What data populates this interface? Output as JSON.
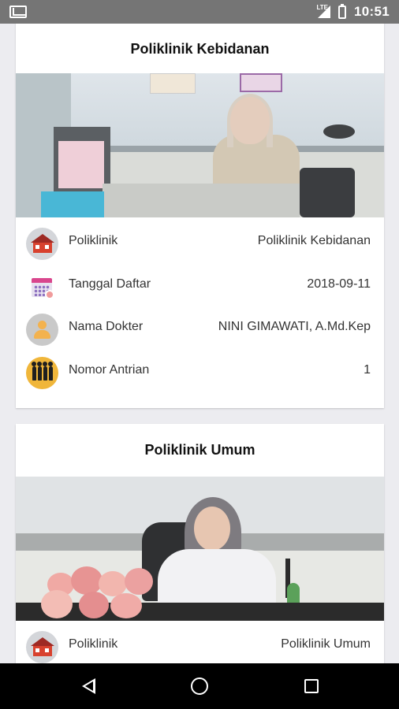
{
  "status_bar": {
    "network": "LTE",
    "time": "10:51",
    "icons": [
      "gmail-icon",
      "signal-icon",
      "battery-icon"
    ]
  },
  "cards": [
    {
      "title": "Poliklinik Kebidanan",
      "rows": [
        {
          "icon": "house-icon",
          "label": "Poliklinik",
          "value": "Poliklinik Kebidanan"
        },
        {
          "icon": "calendar-icon",
          "label": "Tanggal Daftar",
          "value": "2018-09-11"
        },
        {
          "icon": "doctor-icon",
          "label": "Nama Dokter",
          "value": "NINI GIMAWATI, A.Md.Kep"
        },
        {
          "icon": "queue-icon",
          "label": "Nomor Antrian",
          "value": "1"
        }
      ]
    },
    {
      "title": "Poliklinik Umum",
      "rows": [
        {
          "icon": "house-icon",
          "label": "Poliklinik",
          "value": "Poliklinik Umum"
        }
      ]
    }
  ],
  "nav_bar": {
    "icons": [
      "back-icon",
      "home-icon",
      "recents-icon"
    ]
  },
  "colors": {
    "status_bar": "#757575",
    "background": "#ececf0",
    "card": "#ffffff",
    "nav_bar": "#000000"
  }
}
